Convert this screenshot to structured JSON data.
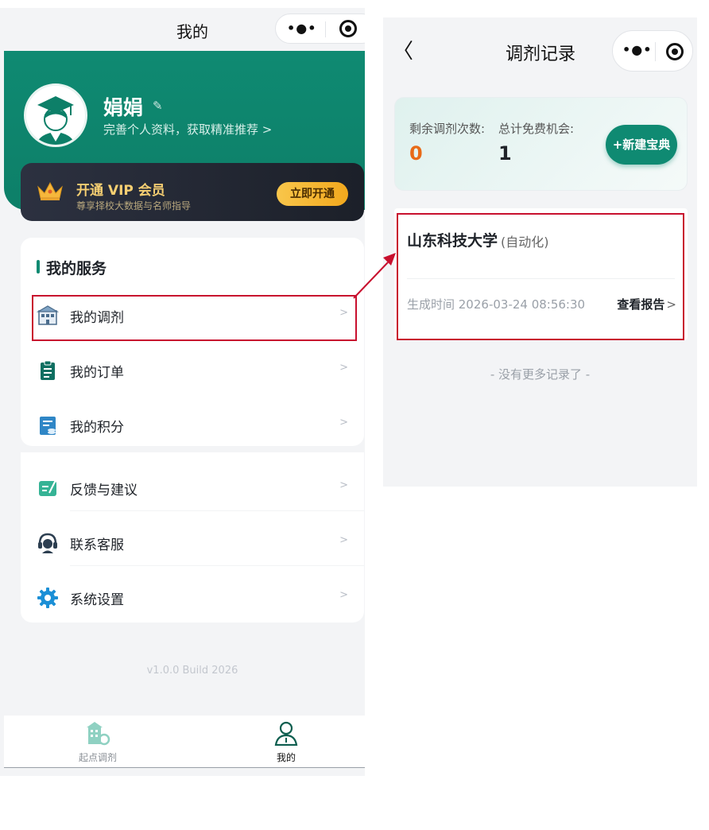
{
  "left": {
    "title": "我的",
    "capsule": {
      "more_icon": "dots-icon",
      "close_icon": "record-icon"
    },
    "profile": {
      "name": "娟娟",
      "subtitle": "完善个人资料，获取精准推荐 >",
      "avatar_icon": "graduate-avatar-icon",
      "edit_icon": "pencil-icon"
    },
    "vip": {
      "title": "开通 VIP 会员",
      "subtitle": "尊享择校大数据与名师指导",
      "button": "立即开通"
    },
    "services": {
      "heading": "我的服务",
      "items": [
        {
          "label": "我的调剂",
          "icon": "building-icon"
        },
        {
          "label": "我的订单",
          "icon": "clipboard-icon"
        },
        {
          "label": "我的积分",
          "icon": "points-ledger-icon"
        }
      ],
      "items2": [
        {
          "label": "反馈与建议",
          "icon": "feedback-edit-icon"
        },
        {
          "label": "联系客服",
          "icon": "headset-icon"
        },
        {
          "label": "系统设置",
          "icon": "gear-icon"
        }
      ],
      "arrow": ">"
    },
    "version": "v1.0.0 Build 2026",
    "tabs": [
      {
        "label": "起点调剂",
        "icon": "campus-icon"
      },
      {
        "label": "我的",
        "icon": "person-icon"
      }
    ],
    "colors": {
      "brand": "#0f8a72",
      "vip_gold": "#f6cf72",
      "highlight": "#c8102e"
    }
  },
  "right": {
    "back": "〈",
    "title": "调剂记录",
    "quota": {
      "remaining_label": "剩余调剂次数:",
      "remaining_value": "0",
      "free_label": "总计免费机会:",
      "free_value": "1",
      "new_button": "+新建宝典"
    },
    "record": {
      "school": "山东科技大学",
      "major": "(自动化)",
      "time": "生成时间 2026-03-24 08:56:30",
      "action": "查看报告",
      "action_arrow": ">"
    },
    "footer": "- 没有更多记录了 -",
    "colors": {
      "accent_orange": "#e86a17"
    }
  }
}
